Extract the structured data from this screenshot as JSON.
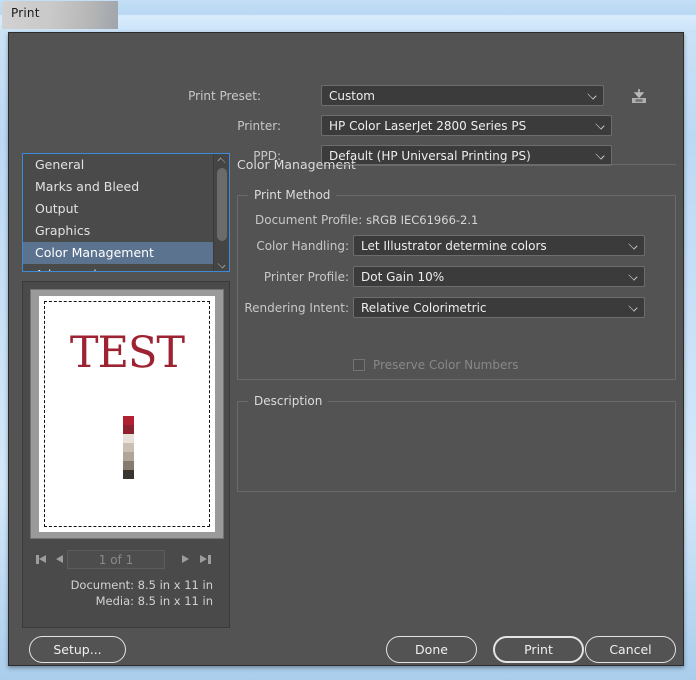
{
  "window": {
    "title": "Print"
  },
  "top": {
    "print_preset_label": "Print Preset:",
    "print_preset_value": "Custom",
    "printer_label": "Printer:",
    "printer_value": "HP Color LaserJet 2800 Series PS",
    "ppd_label": "PPD:",
    "ppd_value": "Default (HP Universal Printing PS)",
    "save_preset_icon": "save-preset-icon"
  },
  "sidebar": {
    "items": [
      {
        "label": "General",
        "selected": false
      },
      {
        "label": "Marks and Bleed",
        "selected": false
      },
      {
        "label": "Output",
        "selected": false
      },
      {
        "label": "Graphics",
        "selected": false
      },
      {
        "label": "Color Management",
        "selected": true
      },
      {
        "label": "Advanced",
        "selected": false
      }
    ],
    "scrollbar": {
      "up_icon": "chevron-up-icon",
      "down_icon": "chevron-down-icon"
    }
  },
  "preview": {
    "page_text": "TEST",
    "swatch_colors": [
      "#b12030",
      "#8c2130",
      "#e6e2d9",
      "#c9bfb3",
      "#b0a597",
      "#857b6e",
      "#3a342f"
    ],
    "nav": {
      "first_icon": "go-to-first-page-icon",
      "prev_icon": "previous-page-icon",
      "page_value": "1 of 1",
      "next_icon": "next-page-icon",
      "last_icon": "go-to-last-page-icon"
    },
    "document_size": "Document: 8.5 in x 11 in",
    "media_size": "Media: 8.5 in x 11 in"
  },
  "main": {
    "panel_title": "Color Management",
    "print_method": {
      "group_title": "Print Method",
      "document_profile_label": "Document Profile:",
      "document_profile_value": "sRGB IEC61966-2.1",
      "color_handling_label": "Color Handling:",
      "color_handling_value": "Let Illustrator determine colors",
      "printer_profile_label": "Printer Profile:",
      "printer_profile_value": "Dot Gain 10%",
      "rendering_intent_label": "Rendering Intent:",
      "rendering_intent_value": "Relative Colorimetric",
      "preserve_color_numbers_label": "Preserve Color Numbers"
    },
    "description": {
      "group_title": "Description",
      "text": ""
    }
  },
  "footer": {
    "setup_label": "Setup...",
    "done_label": "Done",
    "print_label": "Print",
    "cancel_label": "Cancel"
  },
  "colors": {
    "dialog_bg": "#535353",
    "accent_selection": "#5c7390",
    "focus_border": "#3d8ad6",
    "page_title_color": "#9e2332"
  }
}
